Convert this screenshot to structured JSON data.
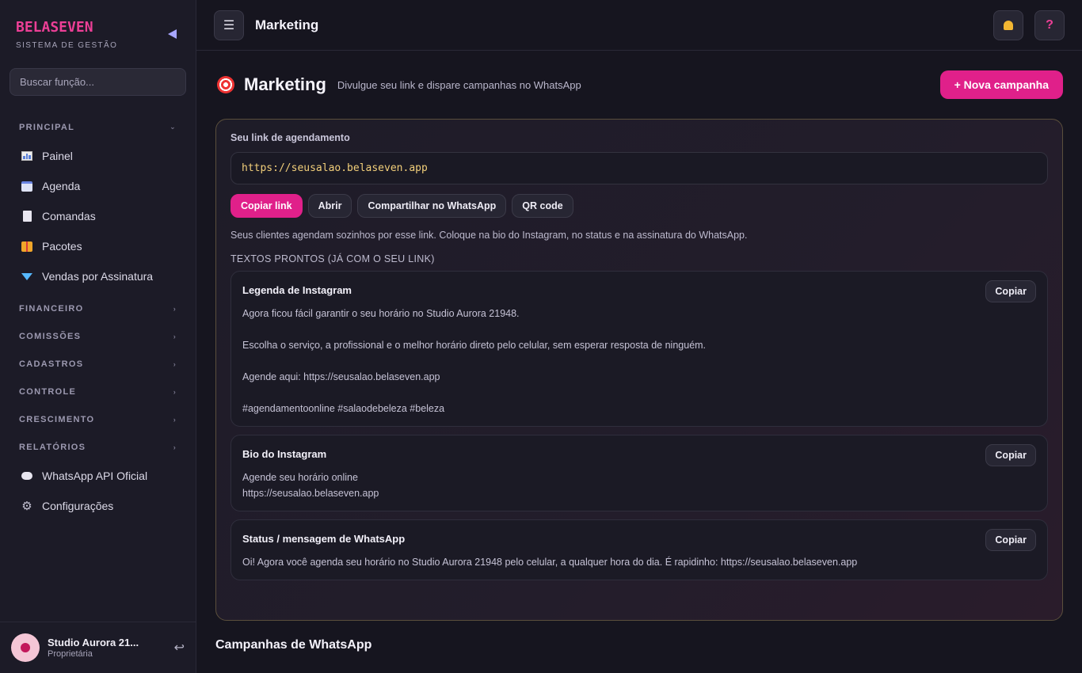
{
  "sidebar": {
    "brand_name": "BELASEVEN",
    "brand_sub": "SISTEMA DE GESTÃO",
    "search_placeholder": "Buscar função...",
    "sections": {
      "principal": "PRINCIPAL",
      "financeiro": "FINANCEIRO",
      "comissoes": "COMISSÕES",
      "cadastros": "CADASTROS",
      "controle": "CONTROLE",
      "crescimento": "CRESCIMENTO",
      "relatorios": "RELATÓRIOS"
    },
    "items": {
      "painel": "Painel",
      "agenda": "Agenda",
      "comandas": "Comandas",
      "pacotes": "Pacotes",
      "vendas": "Vendas por Assinatura",
      "whatsapp": "WhatsApp API Oficial",
      "config": "Configurações"
    },
    "user": {
      "name": "Studio Aurora 21...",
      "role": "Proprietária"
    }
  },
  "topbar": {
    "title": "Marketing"
  },
  "page": {
    "title": "Marketing",
    "subtitle": "Divulgue seu link e dispare campanhas no WhatsApp",
    "new_campaign": "+ Nova campanha"
  },
  "link_card": {
    "label": "Seu link de agendamento",
    "url": "https://seusalao.belaseven.app",
    "buttons": {
      "copy": "Copiar link",
      "open": "Abrir",
      "share": "Compartilhar no WhatsApp",
      "qr": "QR code"
    },
    "hint": "Seus clientes agendam sozinhos por esse link. Coloque na bio do Instagram, no status e na assinatura do WhatsApp.",
    "templates_label": "TEXTOS PRONTOS (JÁ COM O SEU LINK)"
  },
  "templates": {
    "copy_label": "Copiar",
    "instagram_caption": {
      "title": "Legenda de Instagram",
      "line1": "Agora ficou fácil garantir o seu horário no Studio Aurora 21948.",
      "line2": "Escolha o serviço, a profissional e o melhor horário direto pelo celular, sem esperar resposta de ninguém.",
      "line3": "Agende aqui: https://seusalao.belaseven.app",
      "line4": "#agendamentoonline #salaodebeleza #beleza"
    },
    "instagram_bio": {
      "title": "Bio do Instagram",
      "line1": "Agende seu horário online",
      "line2": "https://seusalao.belaseven.app"
    },
    "whatsapp_status": {
      "title": "Status / mensagem de WhatsApp",
      "line1": "Oi! Agora você agenda seu horário no Studio Aurora 21948 pelo celular, a qualquer hora do dia. É rapidinho: https://seusalao.belaseven.app"
    }
  },
  "campaigns": {
    "title": "Campanhas de WhatsApp"
  },
  "icons": {
    "menu": "menu-icon",
    "bell": "bell-icon",
    "help": "help-icon",
    "collapse": "collapse-icon",
    "logout": "logout-icon",
    "target": "target-icon"
  },
  "colors": {
    "accent": "#e0208a",
    "brand": "#ec3f96",
    "link": "#f2cf7a"
  }
}
